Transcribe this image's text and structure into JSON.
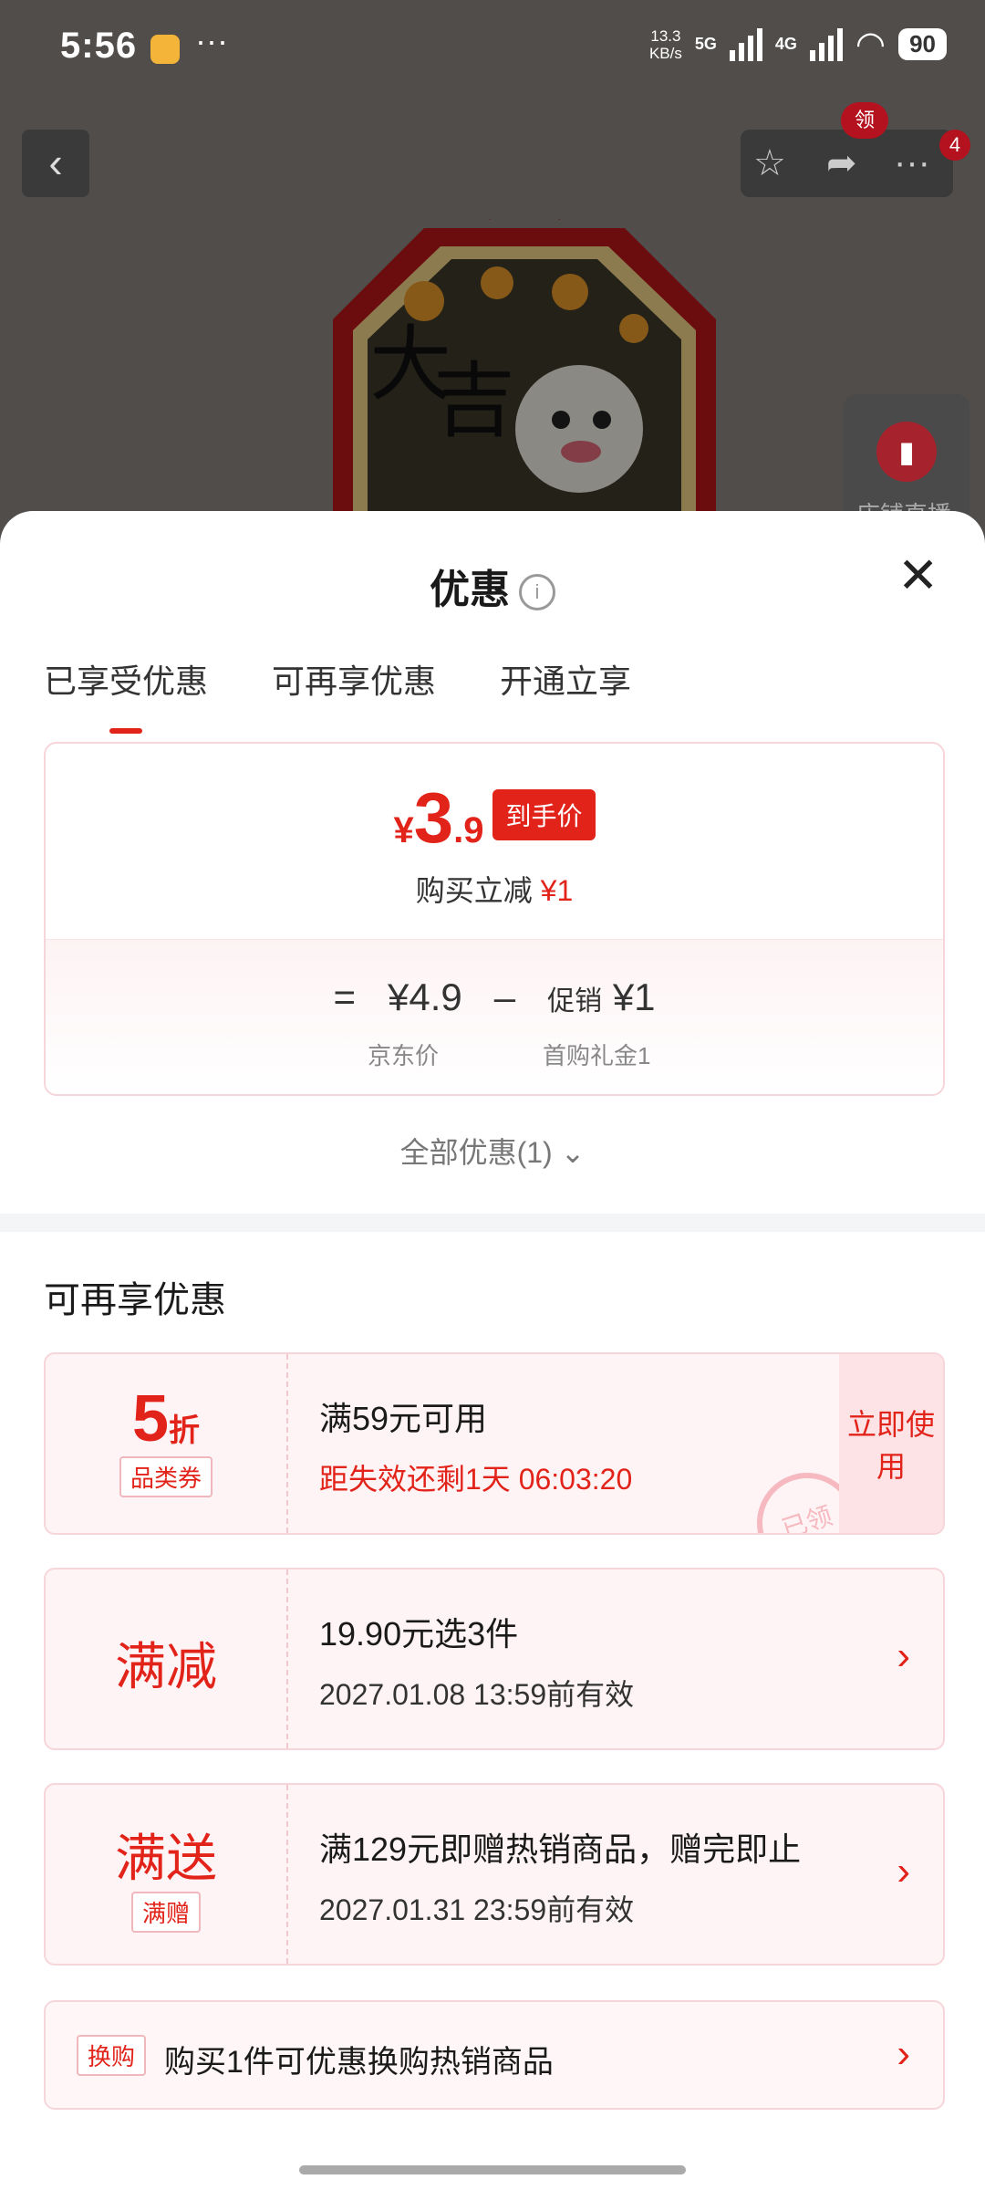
{
  "status_bar": {
    "time": "5:56",
    "net_speed_line1": "13.3",
    "net_speed_line2": "KB/s",
    "signal1": "5G",
    "signal2": "4G",
    "battery": "90"
  },
  "top_bar": {
    "ling_badge": "领",
    "more_badge": "4",
    "live_label": "店铺直播"
  },
  "sheet": {
    "title": "优惠",
    "tabs": [
      "已享受优惠",
      "可再享优惠",
      "开通立享"
    ],
    "price": {
      "currency": "¥",
      "integer": "3",
      "decimal": ".9",
      "final_tag": "到手价",
      "reduce_text": "购买立减",
      "reduce_value": "¥1",
      "eq": "=",
      "base_price": "¥4.9",
      "minus": "–",
      "promo_label": "促销",
      "promo_value": "¥1",
      "base_label": "京东价",
      "promo_sub": "首购礼金1"
    },
    "all_offers": "全部优惠(1)",
    "section_title": "可再享优惠",
    "coupons": [
      {
        "left_big": "5",
        "left_unit": "折",
        "left_tag": "品类券",
        "line1": "满59元可用",
        "line2": "距失效还剩1天 06:03:20",
        "action": "立即使用",
        "stamp": "已领"
      },
      {
        "left_big": "满减",
        "line1": "19.90元选3件",
        "line2": "2027.01.08 13:59前有效"
      },
      {
        "left_big": "满送",
        "left_tag": "满赠",
        "line1": "满129元即赠热销商品，赠完即止",
        "line2": "2027.01.31 23:59前有效"
      }
    ],
    "trade": {
      "tag": "换购",
      "text": "购买1件可优惠换购热销商品"
    }
  },
  "colors": {
    "accent_red": "#e2231a",
    "card_pink": "#fff4f5"
  }
}
